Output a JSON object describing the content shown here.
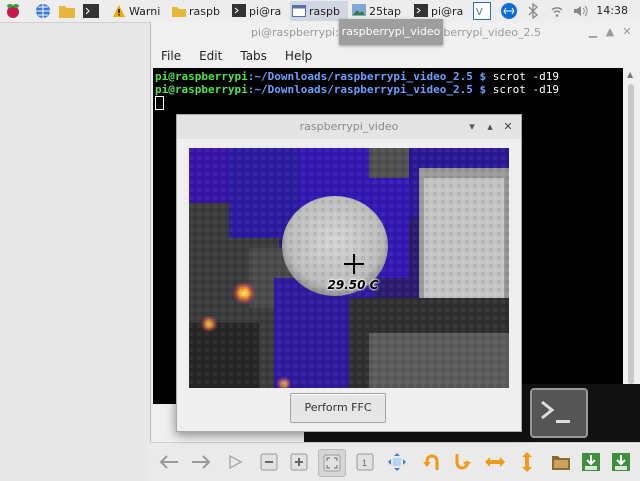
{
  "taskbar": {
    "items": [
      {
        "label": "Warni"
      },
      {
        "label": "raspb"
      },
      {
        "label": "pi@ra"
      },
      {
        "label": "raspb"
      },
      {
        "label": "25tap"
      },
      {
        "label": "pi@ra"
      }
    ],
    "clock": "14:38",
    "tooltip": "raspberrypi_video"
  },
  "terminal": {
    "title": "pi@raspberrypi: ~/Downloads/raspberrypi_video_2.5",
    "menu": [
      "File",
      "Edit",
      "Tabs",
      "Help"
    ],
    "lines": [
      {
        "user": "pi@raspberrypi",
        "path": ":~/Downloads/raspberrypi_video_2.5 $",
        "cmd": " scrot -d19"
      },
      {
        "user": "pi@raspberrypi",
        "path": ":~/Downloads/raspberrypi_video_2.5 $",
        "cmd": " scrot -d19"
      }
    ]
  },
  "video_window": {
    "title": "raspberrypi_video",
    "temperature": "29.50 C",
    "ffc_button": "Perform FFC"
  },
  "colors": {
    "terminal_user": "#4fe24f",
    "terminal_path": "#6aa0ff",
    "thermal_purple": "#3a14a8",
    "thermal_hot": "#ffe04a"
  }
}
